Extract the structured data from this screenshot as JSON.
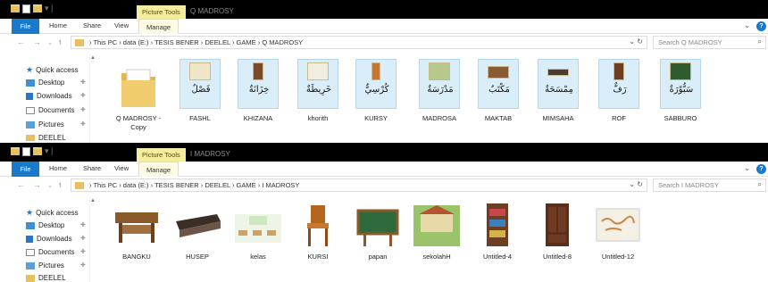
{
  "windows": [
    {
      "context_tab": "Picture Tools",
      "title": "Q MADROSY",
      "ribbon": {
        "file": "File",
        "home": "Home",
        "share": "Share",
        "view": "View",
        "manage": "Manage"
      },
      "breadcrumb": [
        "This PC",
        "data (E:)",
        "TESIS BENER",
        "DEELEL",
        "GAME",
        "Q MADROSY"
      ],
      "search_placeholder": "Search Q MADROSY",
      "sidebar": [
        "Quick access",
        "Desktop",
        "Downloads",
        "Documents",
        "Pictures",
        "DEELEL"
      ],
      "files": [
        {
          "name": "Q MADROSY - Copy",
          "arabic": "",
          "kind": "folder"
        },
        {
          "name": "FASHL",
          "arabic": "فَصْلٌ",
          "kind": "card"
        },
        {
          "name": "KHIZANA",
          "arabic": "خِزَانَةٌ",
          "kind": "card"
        },
        {
          "name": "khorith",
          "arabic": "خَرِيطَةٌ",
          "kind": "card"
        },
        {
          "name": "KURSY",
          "arabic": "كُرْسِيٌّ",
          "kind": "card"
        },
        {
          "name": "MADROSA",
          "arabic": "مَدْرَسَةٌ",
          "kind": "card"
        },
        {
          "name": "MAKTAB",
          "arabic": "مَكْتَبٌ",
          "kind": "card"
        },
        {
          "name": "MIMSAHA",
          "arabic": "مِمْسَحَةٌ",
          "kind": "card"
        },
        {
          "name": "ROF",
          "arabic": "رَفٌّ",
          "kind": "card"
        },
        {
          "name": "SABBURO",
          "arabic": "سَبُّوْرَةٌ",
          "kind": "card"
        }
      ]
    },
    {
      "context_tab": "Picture Tools",
      "title": "I MADROSY",
      "ribbon": {
        "file": "File",
        "home": "Home",
        "share": "Share",
        "view": "View",
        "manage": "Manage"
      },
      "breadcrumb": [
        "This PC",
        "data (E:)",
        "TESIS BENER",
        "DEELEL",
        "GAME",
        "I MADROSY"
      ],
      "search_placeholder": "Search I MADROSY",
      "sidebar": [
        "Quick access",
        "Desktop",
        "Downloads",
        "Documents",
        "Pictures",
        "DEELEL"
      ],
      "files": [
        {
          "name": "BANGKU",
          "kind": "photo"
        },
        {
          "name": "HUSEP",
          "kind": "photo"
        },
        {
          "name": "kelas",
          "kind": "photo"
        },
        {
          "name": "KURSI",
          "kind": "photo"
        },
        {
          "name": "papan",
          "kind": "photo"
        },
        {
          "name": "sekolahH",
          "kind": "photo"
        },
        {
          "name": "Untitled-4",
          "kind": "photo"
        },
        {
          "name": "Untitled-8",
          "kind": "photo"
        },
        {
          "name": "Untitled-12",
          "kind": "photo"
        }
      ]
    }
  ],
  "colors": {
    "accent": "#1979ca",
    "context_tab": "#f4ec9e",
    "card_bg": "#d9eef9",
    "folder": "#e9c060"
  }
}
